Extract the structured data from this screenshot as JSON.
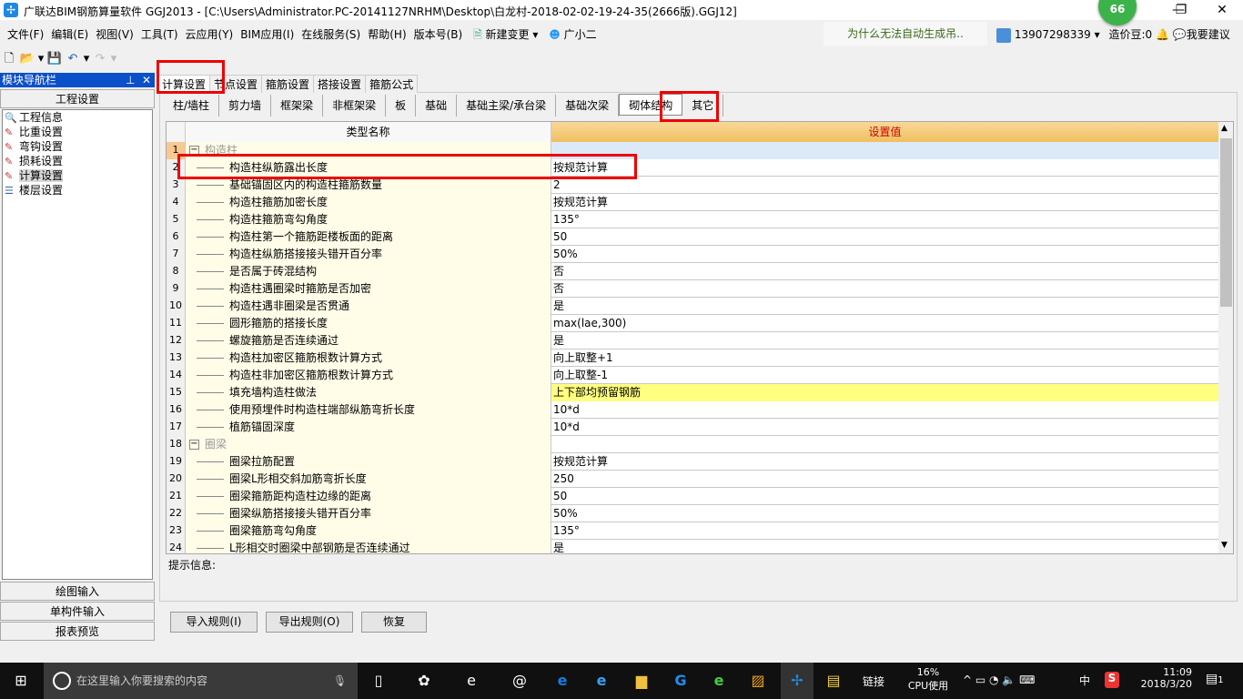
{
  "title": "广联达BIM钢筋算量软件 GGJ2013 - [C:\\Users\\Administrator.PC-20141127NRHM\\Desktop\\白龙村-2018-02-02-19-24-35(2666版).GGJ12]",
  "badge": "66",
  "menu": [
    "文件(F)",
    "编辑(E)",
    "视图(V)",
    "工具(T)",
    "云应用(Y)",
    "BIM应用(I)",
    "在线服务(S)",
    "帮助(H)",
    "版本号(B)",
    "新建变更",
    "广小二"
  ],
  "news": "为什么无法自动生成吊..",
  "user": {
    "phone": "13907298339",
    "beans": "造价豆:0",
    "suggest": "我要建议"
  },
  "nav": {
    "title": "模块导航栏",
    "section": "工程设置",
    "items": [
      "工程信息",
      "比重设置",
      "弯钩设置",
      "损耗设置",
      "计算设置",
      "楼层设置"
    ],
    "bottom": [
      "绘图输入",
      "单构件输入",
      "报表预览"
    ]
  },
  "tabs": [
    "计算设置",
    "节点设置",
    "箍筋设置",
    "搭接设置",
    "箍筋公式"
  ],
  "subtabs": [
    "柱/墙柱",
    "剪力墙",
    "框架梁",
    "非框架梁",
    "板",
    "基础",
    "基础主梁/承台梁",
    "基础次梁",
    "砌体结构",
    "其它"
  ],
  "grid": {
    "col_name": "类型名称",
    "col_value": "设置值",
    "rows": [
      {
        "n": "1",
        "name": "构造柱",
        "value": "",
        "group": true
      },
      {
        "n": "2",
        "name": "构造柱纵筋露出长度",
        "value": "按规范计算"
      },
      {
        "n": "3",
        "name": "基础锚固区内的构造柱箍筋数量",
        "value": "2"
      },
      {
        "n": "4",
        "name": "构造柱箍筋加密长度",
        "value": "按规范计算"
      },
      {
        "n": "5",
        "name": "构造柱箍筋弯勾角度",
        "value": "135°"
      },
      {
        "n": "6",
        "name": "构造柱第一个箍筋距楼板面的距离",
        "value": "50"
      },
      {
        "n": "7",
        "name": "构造柱纵筋搭接接头错开百分率",
        "value": "50%"
      },
      {
        "n": "8",
        "name": "是否属于砖混结构",
        "value": "否"
      },
      {
        "n": "9",
        "name": "构造柱遇圈梁时箍筋是否加密",
        "value": "否"
      },
      {
        "n": "10",
        "name": "构造柱遇非圈梁是否贯通",
        "value": "是"
      },
      {
        "n": "11",
        "name": "圆形箍筋的搭接长度",
        "value": "max(lae,300)"
      },
      {
        "n": "12",
        "name": "螺旋箍筋是否连续通过",
        "value": "是"
      },
      {
        "n": "13",
        "name": "构造柱加密区箍筋根数计算方式",
        "value": "向上取整+1"
      },
      {
        "n": "14",
        "name": "构造柱非加密区箍筋根数计算方式",
        "value": "向上取整-1"
      },
      {
        "n": "15",
        "name": "填充墙构造柱做法",
        "value": "上下部均预留钢筋",
        "highlight": true
      },
      {
        "n": "16",
        "name": "使用预埋件时构造柱端部纵筋弯折长度",
        "value": "10*d"
      },
      {
        "n": "17",
        "name": "植筋锚固深度",
        "value": "10*d"
      },
      {
        "n": "18",
        "name": "圈梁",
        "value": "",
        "group": true
      },
      {
        "n": "19",
        "name": "圈梁拉筋配置",
        "value": "按规范计算"
      },
      {
        "n": "20",
        "name": "圈梁L形相交斜加筋弯折长度",
        "value": "250"
      },
      {
        "n": "21",
        "name": "圈梁箍筋距构造柱边缘的距离",
        "value": "50"
      },
      {
        "n": "22",
        "name": "圈梁纵筋搭接接头错开百分率",
        "value": "50%"
      },
      {
        "n": "23",
        "name": "圈梁箍筋弯勾角度",
        "value": "135°"
      },
      {
        "n": "24",
        "name": "L形相交时圈梁中部钢筋是否连续通过",
        "value": "是"
      }
    ]
  },
  "hint": "提示信息:",
  "buttons": {
    "import": "导入规则(I)",
    "export": "导出规则(O)",
    "restore": "恢复"
  },
  "taskbar": {
    "search": "在这里输入你要搜索的内容",
    "link": "链接",
    "cpu": "16%",
    "cpu_label": "CPU使用",
    "ime": "中",
    "time": "11:09",
    "date": "2018/3/20",
    "notif": "1"
  }
}
